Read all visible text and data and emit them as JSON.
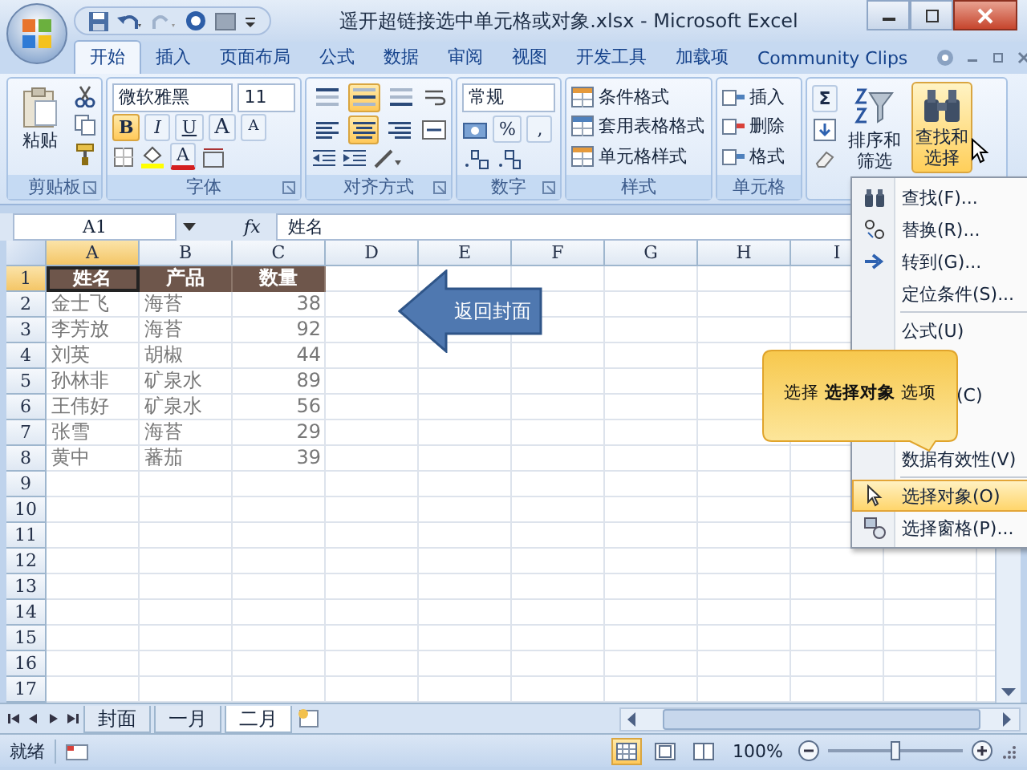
{
  "window": {
    "title": "遥开超链接选中单元格或对象.xlsx - Microsoft Excel"
  },
  "tabs": [
    {
      "label": "开始",
      "selected": true
    },
    {
      "label": "插入",
      "selected": false
    },
    {
      "label": "页面布局",
      "selected": false
    },
    {
      "label": "公式",
      "selected": false
    },
    {
      "label": "数据",
      "selected": false
    },
    {
      "label": "审阅",
      "selected": false
    },
    {
      "label": "视图",
      "selected": false
    },
    {
      "label": "开发工具",
      "selected": false
    },
    {
      "label": "加载项",
      "selected": false
    },
    {
      "label": "Community Clips",
      "selected": false
    }
  ],
  "ribbon": {
    "clipboard": {
      "label": "剪贴板",
      "paste": "粘贴"
    },
    "font": {
      "label": "字体",
      "font_name": "微软雅黑",
      "font_size": "11",
      "font_color": "A",
      "buttons": [
        {
          "label": "B",
          "kind": "bold",
          "on": true
        },
        {
          "label": "I",
          "kind": "italic",
          "on": false
        },
        {
          "label": "U",
          "kind": "underline",
          "on": false
        },
        {
          "label": "A",
          "kind": "grow",
          "on": false
        },
        {
          "label": "A",
          "kind": "shrink",
          "on": false
        }
      ]
    },
    "alignment": {
      "label": "对齐方式",
      "vertical": [
        {
          "selected": false
        },
        {
          "selected": true
        },
        {
          "selected": false
        }
      ],
      "horizontal": [
        {
          "selected": false
        },
        {
          "selected": true
        },
        {
          "selected": false
        }
      ]
    },
    "number": {
      "label": "数字",
      "format": "常规",
      "percent": "%",
      "comma": ","
    },
    "styles": {
      "label": "样式",
      "buttons": [
        "条件格式",
        "套用表格格式",
        "单元格样式"
      ]
    },
    "cells": {
      "label": "单元格",
      "buttons": [
        "插入",
        "删除",
        "格式"
      ]
    },
    "editing": {
      "sum": "Σ",
      "sort_filter": "排序和筛选",
      "find_select": {
        "label": "查找和选择",
        "hover": true
      }
    }
  },
  "formula_bar": {
    "name_box": "A1",
    "function_button": "fx",
    "value": "姓名"
  },
  "sheet": {
    "columns": [
      {
        "label": "A",
        "selected": true
      },
      {
        "label": "B",
        "selected": false
      },
      {
        "label": "C",
        "selected": false
      },
      {
        "label": "D",
        "selected": false
      },
      {
        "label": "E",
        "selected": false
      },
      {
        "label": "F",
        "selected": false
      },
      {
        "label": "G",
        "selected": false
      },
      {
        "label": "H",
        "selected": false
      },
      {
        "label": "I",
        "selected": false
      }
    ],
    "rows": [
      {
        "number": "1",
        "selected": true,
        "kind": "header",
        "cells": [
          "姓名",
          "产品",
          "数量"
        ]
      },
      {
        "number": "2",
        "selected": false,
        "kind": "data",
        "cells": [
          "金士飞",
          "海苔",
          "38"
        ]
      },
      {
        "number": "3",
        "selected": false,
        "kind": "data",
        "cells": [
          "李芳放",
          "海苔",
          "92"
        ]
      },
      {
        "number": "4",
        "selected": false,
        "kind": "data",
        "cells": [
          "刘英",
          "胡椒",
          "44"
        ]
      },
      {
        "number": "5",
        "selected": false,
        "kind": "data",
        "cells": [
          "孙林非",
          "矿泉水",
          "89"
        ]
      },
      {
        "number": "6",
        "selected": false,
        "kind": "data",
        "cells": [
          "王伟好",
          "矿泉水",
          "56"
        ]
      },
      {
        "number": "7",
        "selected": false,
        "kind": "data",
        "cells": [
          "张雪",
          "海苔",
          "29"
        ]
      },
      {
        "number": "8",
        "selected": false,
        "kind": "data",
        "cells": [
          "黄中",
          "蕃茄",
          "39"
        ]
      },
      {
        "number": "9",
        "selected": false,
        "kind": "empty"
      },
      {
        "number": "10",
        "selected": false,
        "kind": "empty"
      },
      {
        "number": "11",
        "selected": false,
        "kind": "empty"
      },
      {
        "number": "12",
        "selected": false,
        "kind": "empty"
      },
      {
        "number": "13",
        "selected": false,
        "kind": "empty"
      },
      {
        "number": "14",
        "selected": false,
        "kind": "empty"
      },
      {
        "number": "15",
        "selected": false,
        "kind": "empty"
      },
      {
        "number": "16",
        "selected": false,
        "kind": "empty"
      },
      {
        "number": "17",
        "selected": false,
        "kind": "empty"
      }
    ]
  },
  "shape": {
    "label": "返回封面"
  },
  "menu": {
    "items": [
      {
        "label": "查找(F)...",
        "kind": "item",
        "selected": false,
        "separator_before": false
      },
      {
        "label": "替换(R)...",
        "kind": "item",
        "selected": false,
        "separator_before": false
      },
      {
        "label": "转到(G)...",
        "kind": "item",
        "selected": false,
        "separator_before": false
      },
      {
        "label": "定位条件(S)...",
        "kind": "item",
        "selected": false,
        "separator_before": false
      },
      {
        "label": "公式(U)",
        "kind": "item",
        "selected": false,
        "separator_before": true
      },
      {
        "label": "(C)",
        "kind": "partial",
        "selected": false,
        "separator_before": false
      },
      {
        "label": "数据有效性(V)",
        "kind": "item",
        "selected": false,
        "separator_before": false
      },
      {
        "label": "选择对象(O)",
        "kind": "item",
        "selected": true,
        "separator_before": true
      },
      {
        "label": "选择窗格(P)...",
        "kind": "item",
        "selected": false,
        "separator_before": false
      }
    ]
  },
  "tooltip": {
    "text": "选择 **选择对象** 选项"
  },
  "sheet_tabs": [
    {
      "label": "封面",
      "selected": false
    },
    {
      "label": "一月",
      "selected": false
    },
    {
      "label": "二月",
      "selected": true
    }
  ],
  "status_bar": {
    "status": "就绪",
    "zoom": "100%",
    "zoom_slider": {
      "level": 0.5
    },
    "views": [
      {
        "selected": true
      },
      {
        "selected": false
      },
      {
        "selected": false
      }
    ]
  }
}
